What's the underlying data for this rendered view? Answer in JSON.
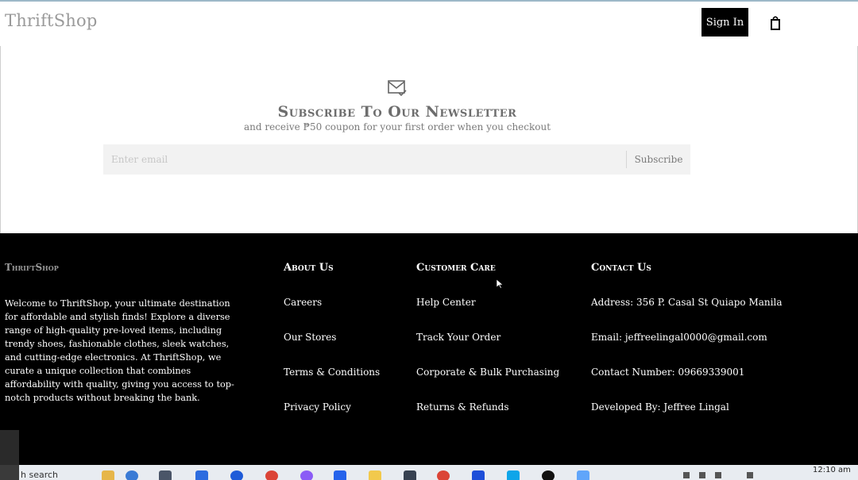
{
  "header": {
    "logo": "ThriftShop",
    "sign_in": "Sign In",
    "cart_icon": "shopping-bag-icon"
  },
  "newsletter": {
    "icon": "mail-check-icon",
    "title": "Subscribe To Our Newsletter",
    "subtitle": "and receive ₱50 coupon for your first order when you checkout",
    "email_placeholder": "Enter email",
    "email_value": "",
    "subscribe_label": "Subscribe"
  },
  "footer": {
    "brand": "ThriftShop",
    "about": "Welcome to ThriftShop, your ultimate destination for affordable and stylish finds! Explore a diverse range of high-quality pre-loved items, including trendy shoes, fashionable clothes, sleek watches, and cutting-edge electronics. At ThriftShop, we curate a unique collection that combines affordability with quality, giving you access to top-notch products without breaking the bank.",
    "columns": [
      {
        "heading": "About Us",
        "links": [
          "Careers",
          "Our Stores",
          "Terms & Conditions",
          "Privacy Policy"
        ]
      },
      {
        "heading": "Customer Care",
        "links": [
          "Help Center",
          "Track Your Order",
          "Corporate & Bulk Purchasing",
          "Returns & Refunds"
        ]
      },
      {
        "heading": "Contact Us",
        "links": [
          "Address: 356 P. Casal St Quiapo Manila",
          "Email: jeffreelingal0000@gmail.com",
          "Contact Number: 09669339001",
          "Developed By: Jeffree Lingal"
        ]
      }
    ]
  },
  "taskbar": {
    "search_text": "h search",
    "clock": "12:10 am",
    "colors": {
      "background": "#e8ecf1"
    }
  },
  "colors": {
    "footer_bg": "#000000",
    "signin_bg": "#000000",
    "input_bg": "#f2f2f2",
    "logo_gray": "#9a9a9a"
  }
}
